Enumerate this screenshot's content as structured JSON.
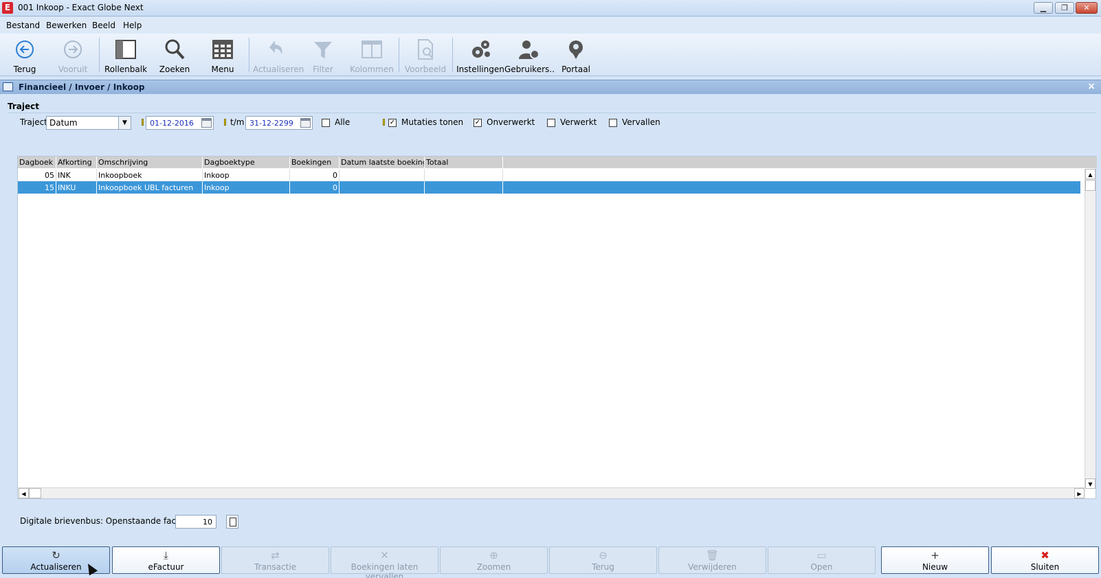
{
  "window": {
    "title": "001 Inkoop - Exact Globe Next",
    "logo_letter": "E",
    "controls": [
      "minimize",
      "restore",
      "close"
    ]
  },
  "menu": [
    "Bestand",
    "Bewerken",
    "Beeld",
    "Help"
  ],
  "toolbar": [
    {
      "label": "Terug",
      "icon": "back-arrow-icon",
      "enabled": true
    },
    {
      "label": "Vooruit",
      "icon": "forward-arrow-icon",
      "enabled": false
    },
    {
      "label": "Rollenbalk",
      "icon": "rolebar-icon",
      "enabled": true
    },
    {
      "label": "Zoeken",
      "icon": "search-icon",
      "enabled": true
    },
    {
      "label": "Menu",
      "icon": "grid-menu-icon",
      "enabled": true
    },
    {
      "label": "Actualiseren",
      "icon": "refresh-icon",
      "enabled": false
    },
    {
      "label": "Filter",
      "icon": "filter-icon",
      "enabled": false
    },
    {
      "label": "Kolommen",
      "icon": "columns-icon",
      "enabled": false
    },
    {
      "label": "Voorbeeld",
      "icon": "preview-icon",
      "enabled": false
    },
    {
      "label": "Instellingen",
      "icon": "gears-icon",
      "enabled": true
    },
    {
      "label": "Gebruikers..",
      "icon": "users-gear-icon",
      "enabled": true
    },
    {
      "label": "Portaal",
      "icon": "portal-icon",
      "enabled": true
    }
  ],
  "document": {
    "breadcrumb": "Financieel / Invoer / Inkoop",
    "close": "×"
  },
  "filter": {
    "section_title": "Traject",
    "traject_label": "Traject",
    "traject_value": "Datum",
    "date_from": "01-12-2016",
    "tm_label": "t/m",
    "date_to": "31-12-2299",
    "checkboxes": [
      {
        "label": "Alle",
        "checked": false
      },
      {
        "label": "Mutaties tonen",
        "checked": true
      },
      {
        "label": "Onverwerkt",
        "checked": true
      },
      {
        "label": "Verwerkt",
        "checked": false
      },
      {
        "label": "Vervallen",
        "checked": false
      }
    ]
  },
  "grid": {
    "columns": [
      "Dagboek",
      "Afkorting",
      "Omschrijving",
      "Dagboektype",
      "Boekingen",
      "Datum laatste boeking",
      "Totaal"
    ],
    "rows": [
      {
        "dagboek": "05",
        "afkorting": "INK",
        "omschrijving": "Inkoopboek",
        "dagboektype": "Inkoop",
        "boekingen": "0",
        "datum": "",
        "totaal": "",
        "selected": false
      },
      {
        "dagboek": "15",
        "afkorting": "INKU",
        "omschrijving": "Inkoopboek UBL facturen",
        "dagboektype": "Inkoop",
        "boekingen": "0",
        "datum": "",
        "totaal": "",
        "selected": true
      }
    ]
  },
  "footer_field": {
    "label": "Digitale brievenbus: Openstaande facturen",
    "value": "10"
  },
  "buttons": [
    {
      "label": "Actualiseren",
      "icon": "refresh-icon",
      "glyph": "↻",
      "state": "pressed"
    },
    {
      "label": "eFactuur",
      "icon": "download-icon",
      "glyph": "⤓",
      "state": "active"
    },
    {
      "label": "Transactie",
      "icon": "handshake-icon",
      "glyph": "⇄",
      "state": "disabled"
    },
    {
      "label": "Boekingen laten vervallen",
      "icon": "cross-icon",
      "glyph": "✕",
      "state": "disabled"
    },
    {
      "label": "Zoomen",
      "icon": "zoom-icon",
      "glyph": "⊕",
      "state": "disabled"
    },
    {
      "label": "Terug",
      "icon": "zoom-out-icon",
      "glyph": "⊖",
      "state": "disabled"
    },
    {
      "label": "Verwijderen",
      "icon": "trash-icon",
      "glyph": "🗑",
      "state": "disabled"
    },
    {
      "label": "Open",
      "icon": "folder-icon",
      "glyph": "▭",
      "state": "disabled"
    },
    {
      "label": "Nieuw",
      "icon": "plus-icon",
      "glyph": "+",
      "state": "active"
    },
    {
      "label": "Sluiten",
      "icon": "close-red-icon",
      "glyph": "✖",
      "state": "active"
    }
  ]
}
